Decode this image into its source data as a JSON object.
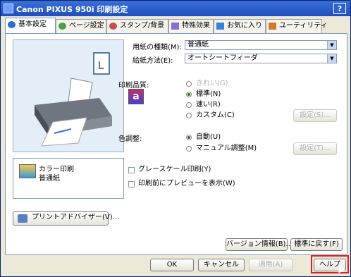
{
  "window": {
    "title": "Canon PIXUS 950i 印刷設定",
    "help_label": "?",
    "accent": "#2456C8"
  },
  "tabs": [
    {
      "label": "基本設定",
      "icon": "basic-settings-icon"
    },
    {
      "label": "ページ設定",
      "icon": "page-setup-icon"
    },
    {
      "label": "スタンプ/背景",
      "icon": "stamp-icon"
    },
    {
      "label": "特殊効果",
      "icon": "effects-icon"
    },
    {
      "label": "お気に入り",
      "icon": "favorites-icon"
    },
    {
      "label": "ユーティリティ",
      "icon": "utility-icon"
    }
  ],
  "basic": {
    "media_type_label": "用紙の種類(M):",
    "media_type_value": "普通紙",
    "paper_source_label": "給紙方法(E):",
    "paper_source_value": "オートシートフィーダ",
    "quality_label": "印刷品質:",
    "quality_options": [
      "きれい(G)",
      "標準(N)",
      "速い(R)",
      "カスタム(C)"
    ],
    "quality_selected": "標準(N)",
    "quality_set_button": "設定(S)...",
    "color_label": "色調整:",
    "color_options": [
      "自動(U)",
      "マニュアル調整(M)"
    ],
    "color_selected": "自動(U)",
    "color_set_button": "設定(T)...",
    "grayscale_label": "グレースケール印刷(Y)",
    "preview_label": "印刷前にプレビューを表示(W)",
    "info_line1": "カラー印刷",
    "info_line2": "普通紙",
    "advisor_button": "プリントアドバイザー(V)...",
    "version_button": "バージョン情報(B)...",
    "defaults_button": "標準に戻す(F)"
  },
  "footer": {
    "ok": "OK",
    "cancel": "キャンセル",
    "apply": "適用(A)",
    "help": "ヘルプ"
  }
}
